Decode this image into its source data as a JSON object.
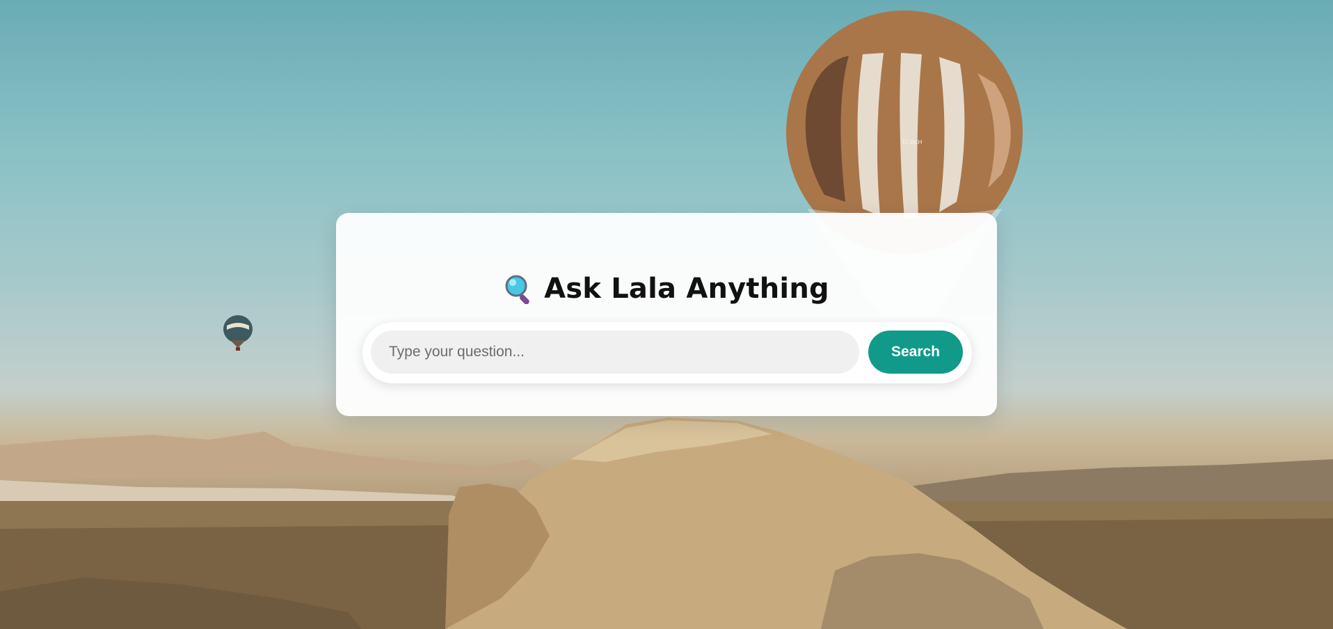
{
  "app": {
    "title": "Ask Lala Anything"
  },
  "search": {
    "placeholder": "Type your question...",
    "value": "",
    "button_label": "Search"
  },
  "icons": {
    "title_icon": "magnifying-glass-icon"
  },
  "colors": {
    "accent": "#119a8a",
    "card_background": "#ffffff",
    "input_background": "#f0f0f0"
  },
  "background": {
    "scene": "hot-air-balloons-over-rocky-landscape",
    "balloon_label": "TC-BKH"
  }
}
